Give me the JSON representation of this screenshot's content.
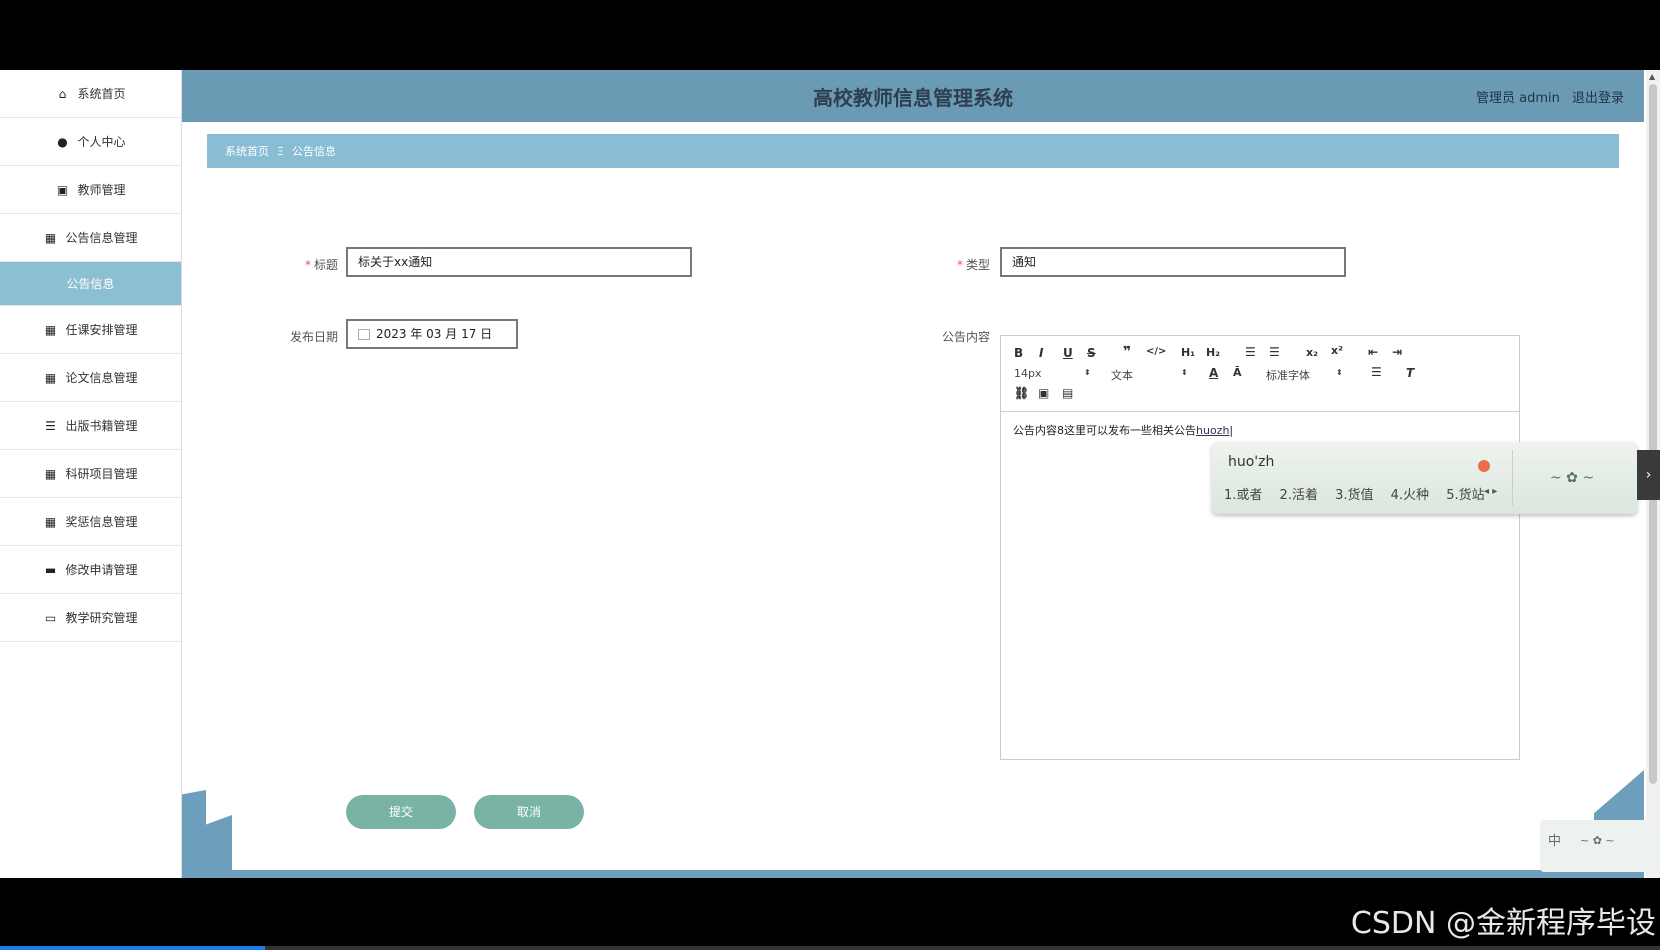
{
  "sidebar": {
    "items": [
      {
        "label": "系统首页",
        "icon": "home-icon",
        "glyph": "⌂"
      },
      {
        "label": "个人中心",
        "icon": "user-icon",
        "glyph": "●"
      },
      {
        "label": "教师管理",
        "icon": "clipboard-icon",
        "glyph": "▣"
      },
      {
        "label": "公告信息管理",
        "icon": "grid-icon",
        "glyph": "▦"
      }
    ],
    "active_sub": "公告信息",
    "items2": [
      {
        "label": "任课安排管理",
        "icon": "grid-icon",
        "glyph": "▦"
      },
      {
        "label": "论文信息管理",
        "icon": "grid-icon",
        "glyph": "▦"
      },
      {
        "label": "出版书籍管理",
        "icon": "sliders-icon",
        "glyph": "☰"
      },
      {
        "label": "科研项目管理",
        "icon": "grid-icon",
        "glyph": "▦"
      },
      {
        "label": "奖惩信息管理",
        "icon": "grid-icon",
        "glyph": "▦"
      },
      {
        "label": "修改申请管理",
        "icon": "comment-icon",
        "glyph": "▬"
      },
      {
        "label": "教学研究管理",
        "icon": "monitor-icon",
        "glyph": "▭"
      }
    ]
  },
  "header": {
    "title": "高校教师信息管理系统",
    "user": "管理员 admin",
    "logout": "退出登录"
  },
  "breadcrumb": {
    "home": "系统首页",
    "sep": "Ξ",
    "current": "公告信息"
  },
  "form": {
    "title_label": "标题",
    "title_value": "标关于xx通知",
    "type_label": "类型",
    "type_value": "通知",
    "date_label": "发布日期",
    "date_value": "2023 年 03 月 17 日",
    "content_label": "公告内容",
    "submit": "提交",
    "cancel": "取消"
  },
  "editor": {
    "font_size": "14px",
    "block_type": "文本",
    "font_family": "标准字体",
    "content": "公告内容8这里可以发布一些相关公告",
    "composing": "huozh"
  },
  "ime": {
    "pinyin": "huo'zh",
    "candidates": [
      "1.或者",
      "2.活着",
      "3.货值",
      "4.火种",
      "5.货站"
    ],
    "mini_label": "中"
  },
  "watermark": "CSDN @金新程序毕设"
}
